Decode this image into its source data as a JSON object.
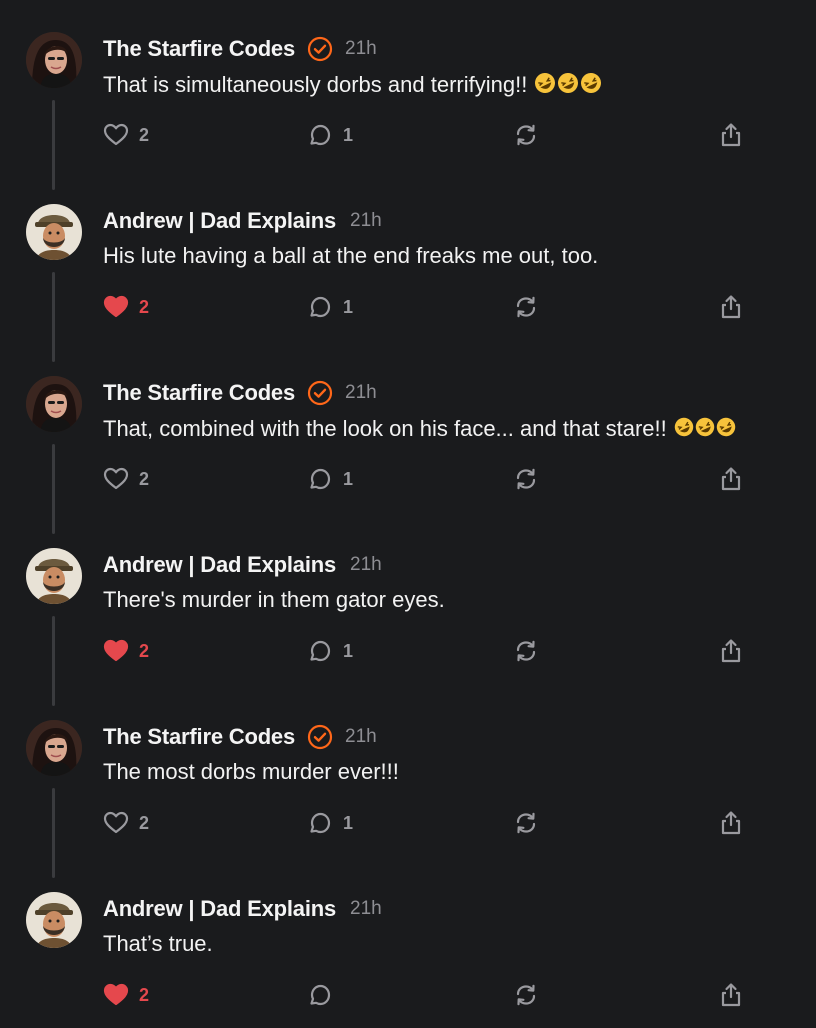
{
  "colors": {
    "background": "#1a1b1d",
    "accent_badge": "#ff6719",
    "liked": "#e5484d",
    "muted": "#9a9a9f"
  },
  "posts": [
    {
      "author": "The Starfire Codes",
      "verified": true,
      "time": "21h",
      "text": "That is simultaneously dorbs and terrifying!!",
      "emoji": "rolling-on-floor-laughing x3",
      "likes": "2",
      "liked": false,
      "replies": "1"
    },
    {
      "author": "Andrew | Dad Explains",
      "verified": false,
      "time": "21h",
      "text": "His lute having a ball at the end freaks me out, too.",
      "likes": "2",
      "liked": true,
      "replies": "1"
    },
    {
      "author": "The Starfire Codes",
      "verified": true,
      "time": "21h",
      "text": "That, combined with the look on his face... and that stare!!",
      "emoji": "rolling-on-floor-laughing x3",
      "likes": "2",
      "liked": false,
      "replies": "1"
    },
    {
      "author": "Andrew | Dad Explains",
      "verified": false,
      "time": "21h",
      "text": "There's murder in them gator eyes.",
      "likes": "2",
      "liked": true,
      "replies": "1"
    },
    {
      "author": "The Starfire Codes",
      "verified": true,
      "time": "21h",
      "text": "The most dorbs murder ever!!!",
      "likes": "2",
      "liked": false,
      "replies": "1"
    },
    {
      "author": "Andrew | Dad Explains",
      "verified": false,
      "time": "21h",
      "text": "That’s true.",
      "likes": "2",
      "liked": true,
      "replies": ""
    }
  ],
  "icons": {
    "like": "heart-icon",
    "reply": "speech-bubble-icon",
    "restack": "restack-arrows-icon",
    "share": "share-upload-icon",
    "verified": "check-badge-icon"
  }
}
